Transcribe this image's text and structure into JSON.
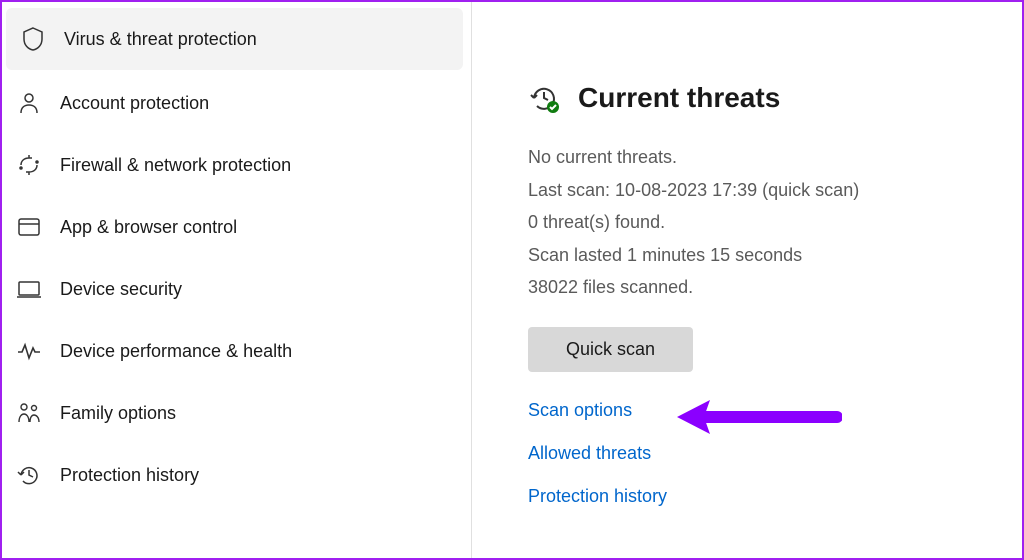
{
  "sidebar": {
    "items": [
      {
        "label": "Virus & threat protection",
        "icon": "shield-icon",
        "active": true
      },
      {
        "label": "Account protection",
        "icon": "account-icon",
        "active": false
      },
      {
        "label": "Firewall & network protection",
        "icon": "firewall-icon",
        "active": false
      },
      {
        "label": "App & browser control",
        "icon": "app-browser-icon",
        "active": false
      },
      {
        "label": "Device security",
        "icon": "device-icon",
        "active": false
      },
      {
        "label": "Device performance & health",
        "icon": "performance-icon",
        "active": false
      },
      {
        "label": "Family options",
        "icon": "family-icon",
        "active": false
      },
      {
        "label": "Protection history",
        "icon": "history-icon",
        "active": false
      }
    ]
  },
  "threats": {
    "heading": "Current threats",
    "status_no_threats": "No current threats.",
    "last_scan": "Last scan: 10-08-2023 17:39 (quick scan)",
    "threats_found": "0 threat(s) found.",
    "scan_duration": "Scan lasted 1 minutes 15 seconds",
    "files_scanned": "38022 files scanned.",
    "quick_scan_label": "Quick scan",
    "links": {
      "scan_options": "Scan options",
      "allowed_threats": "Allowed threats",
      "protection_history": "Protection history"
    }
  },
  "colors": {
    "link": "#0066cc",
    "accent_arrow": "#8b00ff",
    "text_muted": "#5a5a5a"
  }
}
